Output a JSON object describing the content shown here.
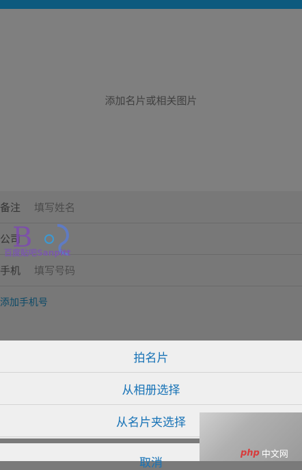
{
  "photo": {
    "label": "添加名片或相关图片"
  },
  "form": {
    "rows": [
      {
        "label": "备注",
        "placeholder": "填写姓名"
      },
      {
        "label": "公司",
        "placeholder": ""
      },
      {
        "label": "手机",
        "placeholder": "填写号码"
      }
    ],
    "add_phone": "添加手机号"
  },
  "sheet": {
    "options": [
      "拍名片",
      "从相册选择",
      "从名片夹选择"
    ],
    "cancel": "取消"
  },
  "watermark": {
    "text": "百度贴吧Sanpitt"
  },
  "badge": {
    "php": "php",
    "cn": "中文网"
  }
}
